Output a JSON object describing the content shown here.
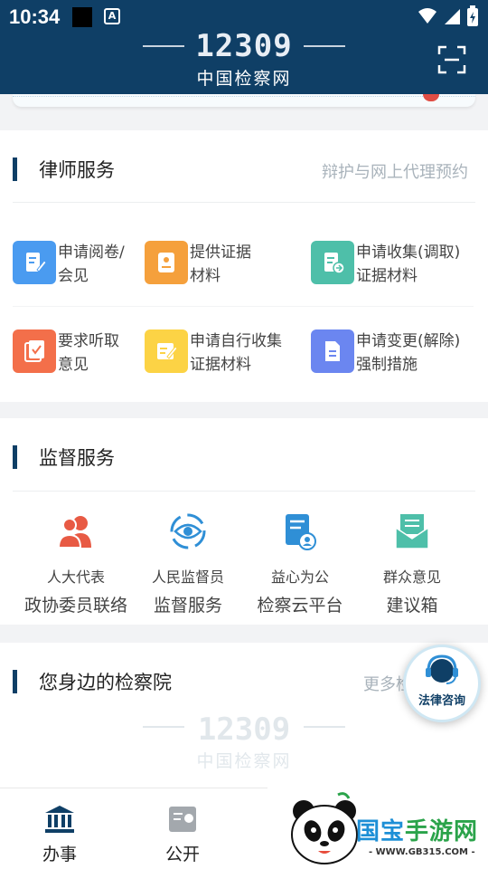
{
  "status_bar": {
    "time": "10:34",
    "a_label": "A"
  },
  "header": {
    "number_logo": "12309",
    "site_name": "中国检察网"
  },
  "lawyer": {
    "title": "律师服务",
    "more": "辩护与网上代理预约",
    "items": [
      {
        "line1": "申请阅卷/",
        "line2": "会见",
        "icon": "document-edit-icon",
        "color": "#4a9bf0"
      },
      {
        "line1": "提供证据",
        "line2": "材料",
        "icon": "evidence-book-icon",
        "color": "#f5a03c"
      },
      {
        "line1": "申请收集(调取)",
        "line2": "证据材料",
        "icon": "document-transfer-icon",
        "color": "#4ebfa9"
      },
      {
        "line1": "要求听取",
        "line2": "意见",
        "icon": "checklist-icon",
        "color": "#f36f4a"
      },
      {
        "line1": "申请自行收集",
        "line2": "证据材料",
        "icon": "note-pen-icon",
        "color": "#fcd345"
      },
      {
        "line1": "申请变更(解除)",
        "line2": "强制措施",
        "icon": "document-lines-icon",
        "color": "#6b86f0"
      }
    ]
  },
  "supervision": {
    "title": "监督服务",
    "items": [
      {
        "line1": "人大代表",
        "line2": "政协委员联络",
        "icon": "people-icon"
      },
      {
        "line1": "人民监督员",
        "line2": "监督服务",
        "icon": "eye-target-icon"
      },
      {
        "line1": "益心为公",
        "line2": "检察云平台",
        "icon": "document-user-icon"
      },
      {
        "line1": "群众意见",
        "line2": "建议箱",
        "icon": "mailbox-icon"
      }
    ]
  },
  "nearby": {
    "title": "您身边的检察院",
    "more": "更多检"
  },
  "watermark": {
    "number": "12309",
    "name": "中国检察网"
  },
  "fab": {
    "label": "法律咨询"
  },
  "nav": [
    {
      "label": "办事",
      "icon": "bank-icon"
    },
    {
      "label": "公开",
      "icon": "public-icon"
    }
  ],
  "ad": {
    "title_part1": "国宝",
    "title_part2": "手游网",
    "url": "- WWW.GB315.COM -"
  },
  "colors": {
    "primary": "#0f3f66",
    "muted": "#a9b3bb"
  }
}
